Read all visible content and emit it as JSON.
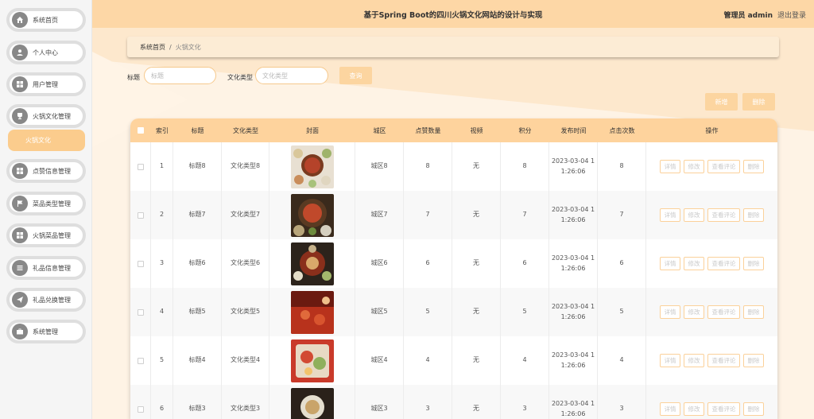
{
  "header": {
    "title": "基于Spring Boot的四川火锅文化网站的设计与实现",
    "user": "管理员 admin",
    "logout": "退出登录"
  },
  "sidebar": {
    "items": [
      {
        "label": "系统首页",
        "icon": "home-icon"
      },
      {
        "label": "个人中心",
        "icon": "user-icon"
      },
      {
        "label": "用户管理",
        "icon": "grid-icon"
      },
      {
        "label": "火锅文化管理",
        "icon": "cup-icon"
      },
      {
        "label": "点赞信息管理",
        "icon": "grid-icon"
      },
      {
        "label": "菜品类型管理",
        "icon": "flag-icon"
      },
      {
        "label": "火锅菜品管理",
        "icon": "grid-icon"
      },
      {
        "label": "礼品信息管理",
        "icon": "list-icon"
      },
      {
        "label": "礼品兑换管理",
        "icon": "send-icon"
      },
      {
        "label": "系统管理",
        "icon": "briefcase-icon"
      }
    ],
    "active_sub": "火锅文化"
  },
  "breadcrumb": {
    "home": "系统首页",
    "separator": "/",
    "current": "火锅文化"
  },
  "search": {
    "title_label": "标题",
    "title_placeholder": "标题",
    "type_label": "文化类型",
    "type_placeholder": "文化类型",
    "query_button": "查询"
  },
  "actions": {
    "add": "新增",
    "delete": "删除"
  },
  "table": {
    "columns": [
      "索引",
      "标题",
      "文化类型",
      "封面",
      "城区",
      "点赞数量",
      "视频",
      "积分",
      "发布时间",
      "点击次数",
      "操作"
    ],
    "row_buttons": [
      "详情",
      "修改",
      "查看评论",
      "删除"
    ],
    "rows": [
      {
        "index": "1",
        "title": "标题8",
        "type": "文化类型8",
        "district": "城区8",
        "likes": "8",
        "video": "无",
        "points": "8",
        "time_l1": "2023-03-04 1",
        "time_l2": "1:26:06",
        "clicks": "8"
      },
      {
        "index": "2",
        "title": "标题7",
        "type": "文化类型7",
        "district": "城区7",
        "likes": "7",
        "video": "无",
        "points": "7",
        "time_l1": "2023-03-04 1",
        "time_l2": "1:26:06",
        "clicks": "7"
      },
      {
        "index": "3",
        "title": "标题6",
        "type": "文化类型6",
        "district": "城区6",
        "likes": "6",
        "video": "无",
        "points": "6",
        "time_l1": "2023-03-04 1",
        "time_l2": "1:26:06",
        "clicks": "6"
      },
      {
        "index": "4",
        "title": "标题5",
        "type": "文化类型5",
        "district": "城区5",
        "likes": "5",
        "video": "无",
        "points": "5",
        "time_l1": "2023-03-04 1",
        "time_l2": "1:26:06",
        "clicks": "5"
      },
      {
        "index": "5",
        "title": "标题4",
        "type": "文化类型4",
        "district": "城区4",
        "likes": "4",
        "video": "无",
        "points": "4",
        "time_l1": "2023-03-04 1",
        "time_l2": "1:26:06",
        "clicks": "4"
      },
      {
        "index": "6",
        "title": "标题3",
        "type": "文化类型3",
        "district": "城区3",
        "likes": "3",
        "video": "无",
        "points": "3",
        "time_l1": "2023-03-04 1",
        "time_l2": "1:26:06",
        "clicks": "3"
      }
    ]
  },
  "colors": {
    "accent": "#fdd7a6",
    "button": "#fcd5a0",
    "active_nav": "#fbcc8d"
  }
}
